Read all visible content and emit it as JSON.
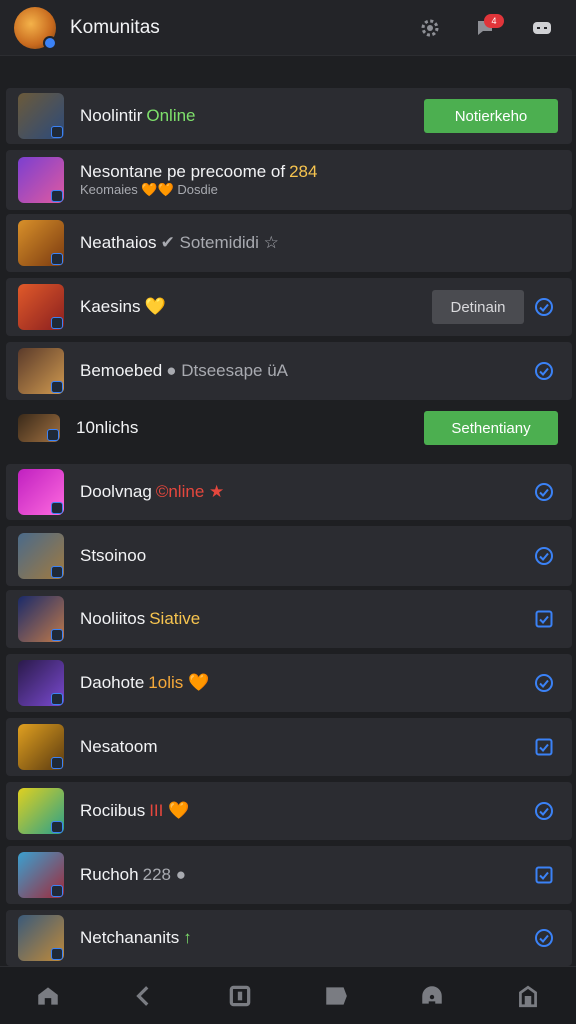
{
  "header": {
    "title": "Komunitas",
    "notif_count": "4"
  },
  "rows": [
    {
      "title": "Noolintir",
      "accent": "Online",
      "accent_color": "#7ee06b",
      "sub": "",
      "action": "button-green",
      "action_label": "Notierkeho"
    },
    {
      "title": "Nesontane pe precoome of",
      "accent": "284",
      "accent_color": "#f6c44f",
      "sub": "Keomaies 🧡🧡 Dosdie",
      "action": "none",
      "action_label": ""
    },
    {
      "title": "Neathaios",
      "accent": "✔ Sotemididi ☆",
      "accent_color": "#a8aab0",
      "sub": "",
      "action": "none",
      "action_label": ""
    },
    {
      "title": "Kaesins",
      "accent": "💛",
      "accent_color": "#f6c44f",
      "sub": "",
      "action": "button-gray-check",
      "action_label": "Detinain"
    },
    {
      "title": "Bemoebed",
      "accent": "● Dtseesape üA",
      "accent_color": "#a8aab0",
      "sub": "",
      "action": "check",
      "action_label": ""
    },
    {
      "title": "10nlichs",
      "accent": "",
      "accent_color": "#ffffff",
      "sub": "",
      "action": "button-green",
      "action_label": "Sethentiany"
    },
    {
      "title": "Doolvnag",
      "accent": "©nline ★",
      "accent_color": "#e5473d",
      "sub": "",
      "action": "check",
      "action_label": ""
    },
    {
      "title": "Stsoinoo",
      "accent": "",
      "accent_color": "#ffffff",
      "sub": "",
      "action": "check",
      "action_label": ""
    },
    {
      "title": "Nooliitos",
      "accent": "Siative",
      "accent_color": "#f6c44f",
      "sub": "",
      "action": "checkbox",
      "action_label": ""
    },
    {
      "title": "Daohote",
      "accent": "1olis 🧡",
      "accent_color": "#f6a93a",
      "sub": "",
      "action": "check",
      "action_label": ""
    },
    {
      "title": "Nesatoom",
      "accent": "",
      "accent_color": "#ffffff",
      "sub": "",
      "action": "checkbox",
      "action_label": ""
    },
    {
      "title": "Rociibus",
      "accent": "III 🧡",
      "accent_color": "#e5473d",
      "sub": "",
      "action": "check",
      "action_label": ""
    },
    {
      "title": "Ruchoh",
      "accent": "228 ●",
      "accent_color": "#a8aab0",
      "sub": "",
      "action": "checkbox",
      "action_label": ""
    },
    {
      "title": "Netchananits",
      "accent": "↑",
      "accent_color": "#7ee06b",
      "sub": "",
      "action": "check",
      "action_label": ""
    }
  ],
  "colors": {
    "background": "#1e1f22",
    "card": "#2b2c31",
    "accent_blue": "#3b82f6",
    "accent_green": "#4caf50"
  },
  "icons": {
    "top": [
      "gear-icon",
      "chat-icon",
      "controller-icon"
    ],
    "bottom": [
      "home-icon",
      "back-icon",
      "square-icon",
      "message-icon",
      "support-icon",
      "menu-icon"
    ]
  }
}
